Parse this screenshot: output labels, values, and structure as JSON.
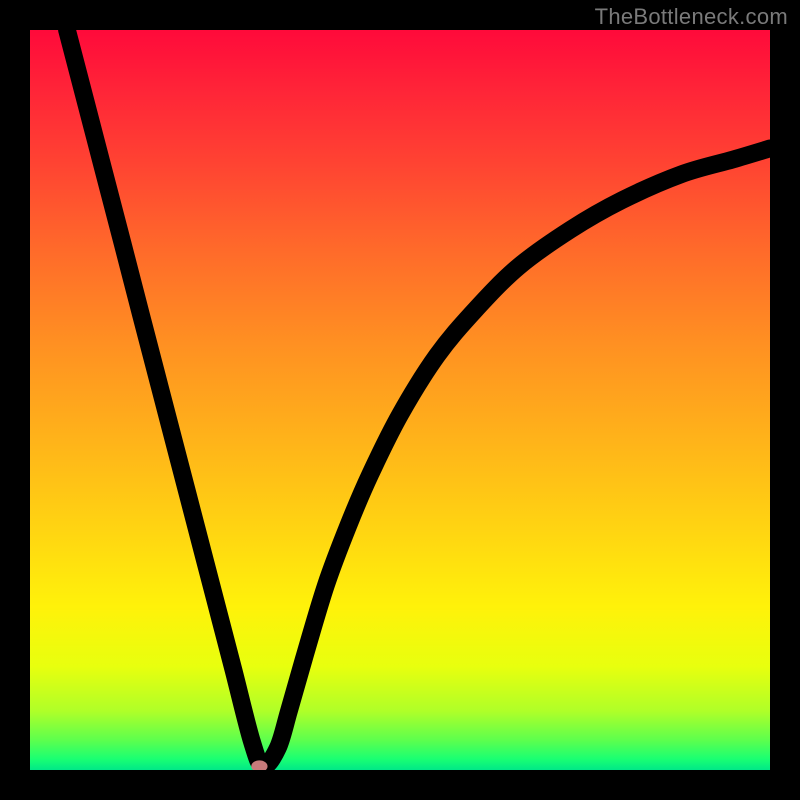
{
  "watermark": "TheBottleneck.com",
  "chart_data": {
    "type": "line",
    "title": "",
    "xlabel": "",
    "ylabel": "",
    "xlim": [
      0,
      100
    ],
    "ylim": [
      0,
      100
    ],
    "grid": false,
    "legend": false,
    "gradient_stops": [
      {
        "pos": 0,
        "color": "#ff0a3a"
      },
      {
        "pos": 8,
        "color": "#ff2438"
      },
      {
        "pos": 18,
        "color": "#ff4332"
      },
      {
        "pos": 30,
        "color": "#ff6b2a"
      },
      {
        "pos": 42,
        "color": "#ff8f22"
      },
      {
        "pos": 55,
        "color": "#ffb21a"
      },
      {
        "pos": 67,
        "color": "#ffd312"
      },
      {
        "pos": 78,
        "color": "#fff20a"
      },
      {
        "pos": 86,
        "color": "#e8ff0e"
      },
      {
        "pos": 92,
        "color": "#b0ff28"
      },
      {
        "pos": 96,
        "color": "#5cff4e"
      },
      {
        "pos": 98.5,
        "color": "#1aff72"
      },
      {
        "pos": 100,
        "color": "#00e888"
      }
    ],
    "series": [
      {
        "name": "curve",
        "x": [
          5.0,
          7.5,
          10.0,
          12.5,
          15.0,
          17.5,
          20.0,
          22.5,
          25.0,
          27.5,
          30.0,
          31.5,
          33.5,
          35.0,
          37.0,
          40.0,
          43.0,
          46.0,
          50.0,
          55.0,
          60.0,
          66.0,
          73.0,
          80.0,
          88.0,
          95.0,
          100.0
        ],
        "values": [
          100.0,
          90.4,
          80.8,
          71.2,
          61.5,
          51.9,
          42.3,
          32.7,
          23.1,
          13.5,
          3.8,
          0.5,
          3.0,
          8.0,
          15.0,
          25.0,
          33.0,
          40.0,
          48.0,
          56.0,
          62.0,
          68.0,
          73.0,
          77.0,
          80.5,
          82.5,
          84.0
        ]
      }
    ],
    "marker": {
      "x": 31.0,
      "y": 0.5,
      "rx": 1.1,
      "ry": 0.8,
      "color": "#c77b7b"
    }
  }
}
